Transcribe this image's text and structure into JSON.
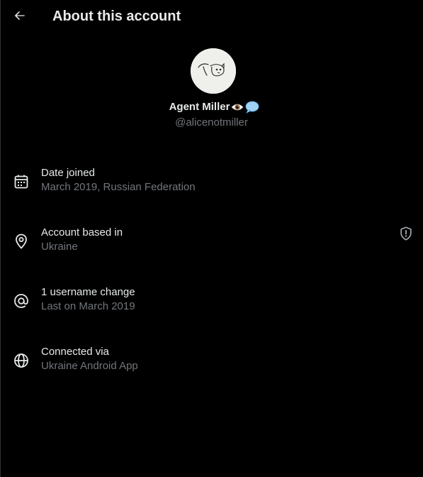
{
  "header": {
    "back_icon": "arrow-left-icon",
    "title": "About this account"
  },
  "profile": {
    "avatar_icon": "cat-sketch-avatar",
    "name": "Agent Miller",
    "emojis": [
      "eye-emoji",
      "speech-bubble-emoji"
    ],
    "handle": "@alicenotmiller"
  },
  "details": [
    {
      "icon": "calendar-icon",
      "title": "Date joined",
      "value": "March 2019, Russian Federation"
    },
    {
      "icon": "location-pin-icon",
      "title": "Account based in",
      "value": "Ukraine",
      "badge_icon": "shield-alert-icon"
    },
    {
      "icon": "at-sign-icon",
      "title": "1 username change",
      "value": "Last on March 2019"
    },
    {
      "icon": "globe-icon",
      "title": "Connected via",
      "value": "Ukraine Android App"
    }
  ],
  "colors": {
    "background": "#000000",
    "primary_text": "#e7e9ea",
    "secondary_text": "#71767b"
  }
}
